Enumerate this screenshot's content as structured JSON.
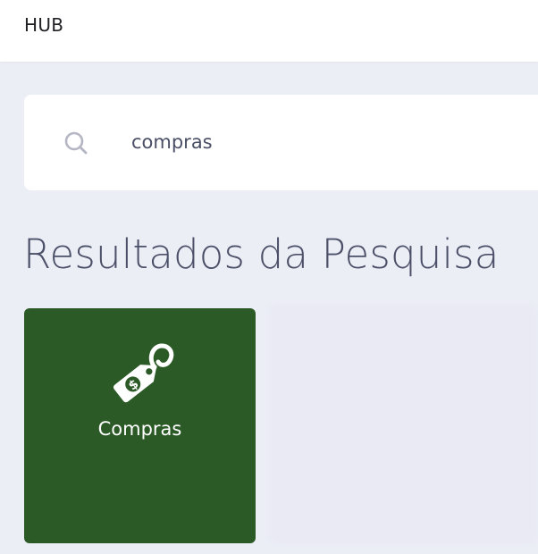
{
  "header": {
    "title": "HUB"
  },
  "search": {
    "value": "compras",
    "icon": "search-icon"
  },
  "results": {
    "title": "Resultados da Pesquisa",
    "items": [
      {
        "label": "Compras",
        "icon": "price-tag-dollar-icon",
        "color": "#2b5a27"
      }
    ]
  }
}
